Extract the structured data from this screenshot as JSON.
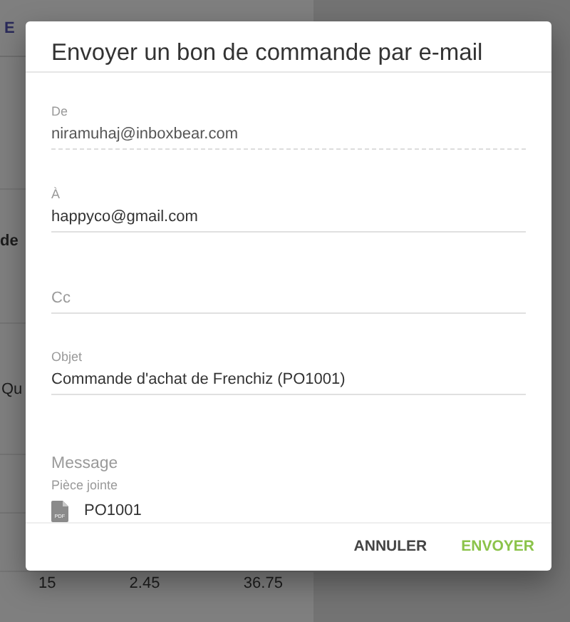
{
  "background": {
    "header_fragment": "E",
    "row_fragment": "de",
    "column_fragment": "Qu",
    "table_row": [
      "15",
      "2.45",
      "36.75"
    ]
  },
  "dialog": {
    "title": "Envoyer un bon de commande par e-mail",
    "fields": [
      {
        "label": "De",
        "value": "niramuhaj@inboxbear.com",
        "disabled": true
      },
      {
        "label": "À",
        "value": "happyco@gmail.com",
        "disabled": false
      },
      {
        "placeholder": "Cc",
        "disabled": false
      },
      {
        "label": "Objet",
        "value": "Commande d'achat de Frenchiz (PO1001)",
        "disabled": false
      }
    ],
    "message": {
      "placeholder": "Message"
    },
    "attachment": {
      "label": "Pièce jointe",
      "file_name": "PO1001",
      "file_type": "PDF"
    },
    "buttons": [
      {
        "label": "ANNULER",
        "primary": false
      },
      {
        "label": "ENVOYER",
        "primary": true
      }
    ]
  }
}
